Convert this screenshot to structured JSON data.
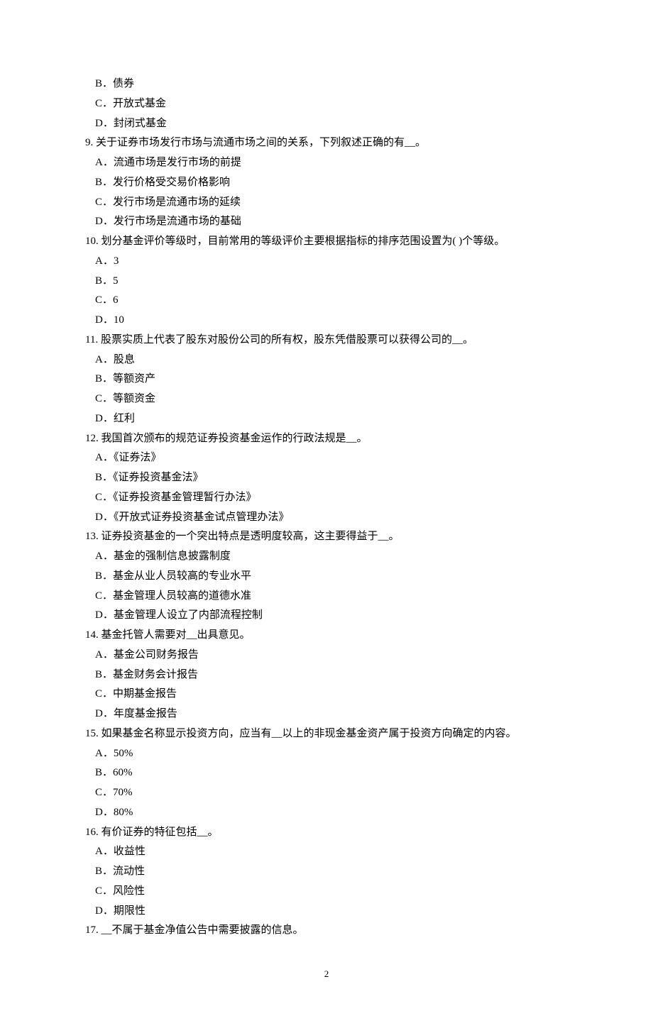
{
  "page_number": "2",
  "items": [
    {
      "kind": "option",
      "letter": "B",
      "text": "债券"
    },
    {
      "kind": "option",
      "letter": "C",
      "text": "开放式基金"
    },
    {
      "kind": "option",
      "letter": "D",
      "text": "封闭式基金"
    },
    {
      "kind": "question",
      "num": "9.",
      "text": " 关于证券市场发行市场与流通市场之间的关系，下列叙述正确的有__。"
    },
    {
      "kind": "option",
      "letter": "A",
      "text": "流通市场是发行市场的前提"
    },
    {
      "kind": "option",
      "letter": "B",
      "text": "发行价格受交易价格影响"
    },
    {
      "kind": "option",
      "letter": "C",
      "text": "发行市场是流通市场的延续"
    },
    {
      "kind": "option",
      "letter": "D",
      "text": "发行市场是流通市场的基础"
    },
    {
      "kind": "question",
      "num": "10.",
      "text": " 划分基金评价等级时，目前常用的等级评价主要根据指标的排序范围设置为( )个等级。"
    },
    {
      "kind": "option",
      "letter": "A",
      "text": "3"
    },
    {
      "kind": "option",
      "letter": "B",
      "text": "5"
    },
    {
      "kind": "option",
      "letter": "C",
      "text": "6"
    },
    {
      "kind": "option",
      "letter": "D",
      "text": "10"
    },
    {
      "kind": "question",
      "num": "11.",
      "text": " 股票实质上代表了股东对股份公司的所有权，股东凭借股票可以获得公司的__。"
    },
    {
      "kind": "option",
      "letter": "A",
      "text": "股息"
    },
    {
      "kind": "option",
      "letter": "B",
      "text": "等额资产"
    },
    {
      "kind": "option",
      "letter": "C",
      "text": "等额资金"
    },
    {
      "kind": "option",
      "letter": "D",
      "text": "红利"
    },
    {
      "kind": "question",
      "num": "12.",
      "text": " 我国首次颁布的规范证券投资基金运作的行政法规是__。"
    },
    {
      "kind": "option",
      "letter": "A",
      "text": "《证券法》"
    },
    {
      "kind": "option",
      "letter": "B",
      "text": "《证券投资基金法》"
    },
    {
      "kind": "option",
      "letter": "C",
      "text": "《证券投资基金管理暂行办法》"
    },
    {
      "kind": "option",
      "letter": "D",
      "text": "《开放式证券投资基金试点管理办法》"
    },
    {
      "kind": "question",
      "num": "13.",
      "text": " 证券投资基金的一个突出特点是透明度较高，这主要得益于__。"
    },
    {
      "kind": "option",
      "letter": "A",
      "text": "基金的强制信息披露制度"
    },
    {
      "kind": "option",
      "letter": "B",
      "text": "基金从业人员较高的专业水平"
    },
    {
      "kind": "option",
      "letter": "C",
      "text": "基金管理人员较高的道德水准"
    },
    {
      "kind": "option",
      "letter": "D",
      "text": "基金管理人设立了内部流程控制"
    },
    {
      "kind": "question",
      "num": "14.",
      "text": " 基金托管人需要对__出具意见。"
    },
    {
      "kind": "option",
      "letter": "A",
      "text": "基金公司财务报告"
    },
    {
      "kind": "option",
      "letter": "B",
      "text": "基金财务会计报告"
    },
    {
      "kind": "option",
      "letter": "C",
      "text": "中期基金报告"
    },
    {
      "kind": "option",
      "letter": "D",
      "text": "年度基金报告"
    },
    {
      "kind": "question",
      "num": "15.",
      "text": " 如果基金名称显示投资方向，应当有__以上的非现金基金资产属于投资方向确定的内容。"
    },
    {
      "kind": "option",
      "letter": "A",
      "text": "50%"
    },
    {
      "kind": "option",
      "letter": "B",
      "text": "60%"
    },
    {
      "kind": "option",
      "letter": "C",
      "text": "70%"
    },
    {
      "kind": "option",
      "letter": "D",
      "text": "80%"
    },
    {
      "kind": "question",
      "num": "16.",
      "text": " 有价证券的特征包括__。"
    },
    {
      "kind": "option",
      "letter": "A",
      "text": "收益性"
    },
    {
      "kind": "option",
      "letter": "B",
      "text": "流动性"
    },
    {
      "kind": "option",
      "letter": "C",
      "text": "风险性"
    },
    {
      "kind": "option",
      "letter": "D",
      "text": "期限性"
    },
    {
      "kind": "question",
      "num": "17.",
      "text": " __不属于基金净值公告中需要披露的信息。"
    }
  ]
}
